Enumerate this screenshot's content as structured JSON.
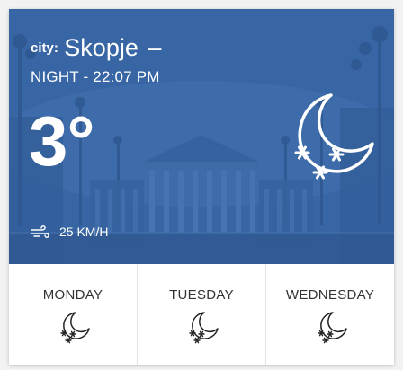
{
  "weather": {
    "city_prefix": "city:",
    "city_name": "Skopje",
    "city_suffix": "–",
    "time_of_day": "NIGHT - 22:07 PM",
    "temperature": "3°",
    "wind_speed": "25 KM/H",
    "current_icon": "moon-snow-icon"
  },
  "forecast": [
    {
      "day": "MONDAY",
      "icon": "moon-snow-icon"
    },
    {
      "day": "TUESDAY",
      "icon": "moon-snow-icon"
    },
    {
      "day": "WEDNESDAY",
      "icon": "moon-snow-icon"
    }
  ],
  "colors": {
    "hero_tint": "#3d6aa8",
    "text_on_hero": "#ffffff",
    "forecast_text": "#333333",
    "divider": "#e3e3e3"
  }
}
